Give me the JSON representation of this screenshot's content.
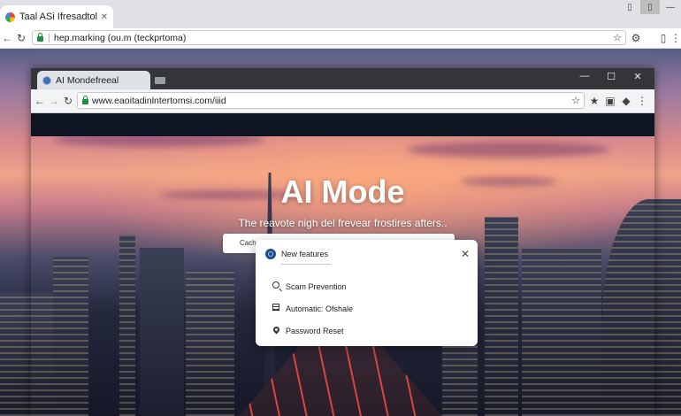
{
  "outer_browser": {
    "tab": {
      "title": "Taal ASi Ifresadtolotop",
      "close": "✕"
    },
    "window_controls": {
      "icon_a": "▯",
      "icon_b": "▯",
      "minimize": "—"
    },
    "address": {
      "url": "hep.marking (ou.m (teckprtoma)"
    },
    "icons": [
      "back-arrow-icon",
      "reload-icon",
      "star-icon",
      "extension-icon",
      "cast-icon",
      "menu-icon"
    ]
  },
  "inner_browser": {
    "tab": {
      "title": "AI Mondefreeal"
    },
    "window_controls": {
      "minimize": "—",
      "maximize": "☐",
      "close": "✕"
    },
    "address": {
      "url": "www.eaoitadinlntertomsi.com/iiid"
    }
  },
  "page": {
    "hero_title": "AI Mode",
    "hero_subtitle": "The reavote nigh del frevear frostires afters..",
    "search_placeholder": "Cachel"
  },
  "popup": {
    "title": "New features",
    "close": "✕",
    "items": [
      {
        "label": "Scam Prevention",
        "icon": "search-icon"
      },
      {
        "label": "Automatic: Ofshale",
        "icon": "calendar-icon"
      },
      {
        "label": "Password Reset",
        "icon": "location-pin-icon"
      }
    ]
  },
  "colors": {
    "lock_green": "#1e8e3e",
    "inner_tabbar": "#35363a",
    "outer_tabbar": "#dfe1e5"
  }
}
